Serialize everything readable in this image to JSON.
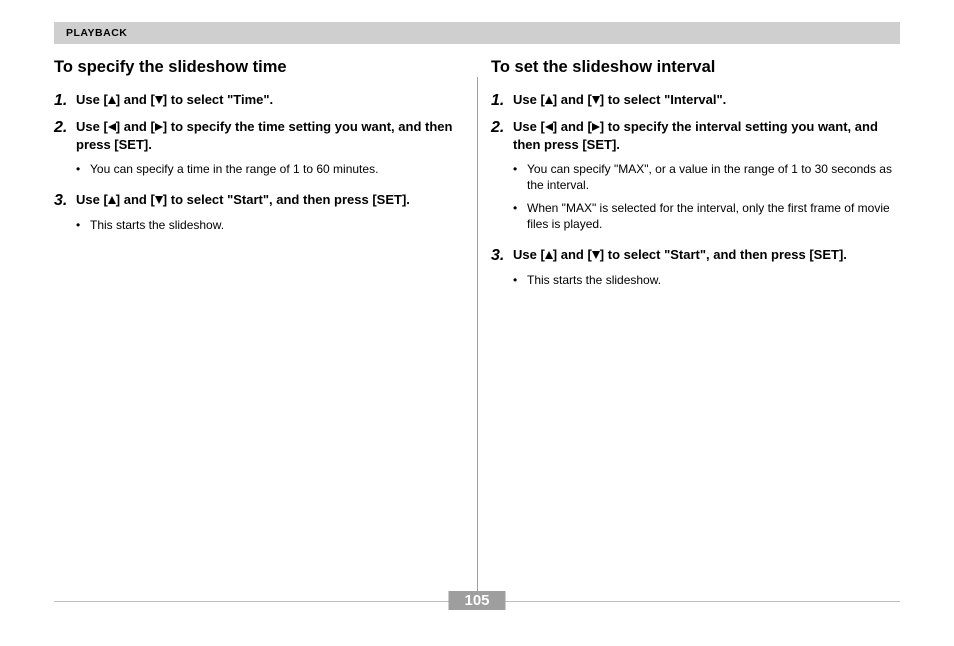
{
  "section_header": "PLAYBACK",
  "page_number": "105",
  "left": {
    "heading": "To specify the slideshow time",
    "steps": [
      {
        "n": "1.",
        "parts": [
          "Use [",
          "UP",
          "] and [",
          "DOWN",
          "] to select \"Time\"."
        ],
        "bullets": []
      },
      {
        "n": "2.",
        "parts": [
          "Use [",
          "LEFT",
          "] and [",
          "RIGHT",
          "] to specify the time setting you want, and then press [SET]."
        ],
        "bullets": [
          "You can specify a time in the range of 1 to 60 minutes."
        ]
      },
      {
        "n": "3.",
        "parts": [
          "Use [",
          "UP",
          "] and [",
          "DOWN",
          "] to select \"Start\", and then press [SET]."
        ],
        "bullets": [
          "This starts the slideshow."
        ]
      }
    ]
  },
  "right": {
    "heading": "To set the slideshow interval",
    "steps": [
      {
        "n": "1.",
        "parts": [
          "Use [",
          "UP",
          "] and [",
          "DOWN",
          "] to select \"Interval\"."
        ],
        "bullets": []
      },
      {
        "n": "2.",
        "parts": [
          "Use [",
          "LEFT",
          "] and [",
          "RIGHT",
          "] to specify the interval setting you want, and then press [SET]."
        ],
        "bullets": [
          "You can specify \"MAX\", or a value in the range of 1 to 30 seconds as the interval.",
          "When \"MAX\" is selected for the interval, only the first frame of movie files is played."
        ]
      },
      {
        "n": "3.",
        "parts": [
          "Use [",
          "UP",
          "] and [",
          "DOWN",
          "] to select \"Start\", and then press [SET]."
        ],
        "bullets": [
          "This starts the slideshow."
        ]
      }
    ]
  }
}
